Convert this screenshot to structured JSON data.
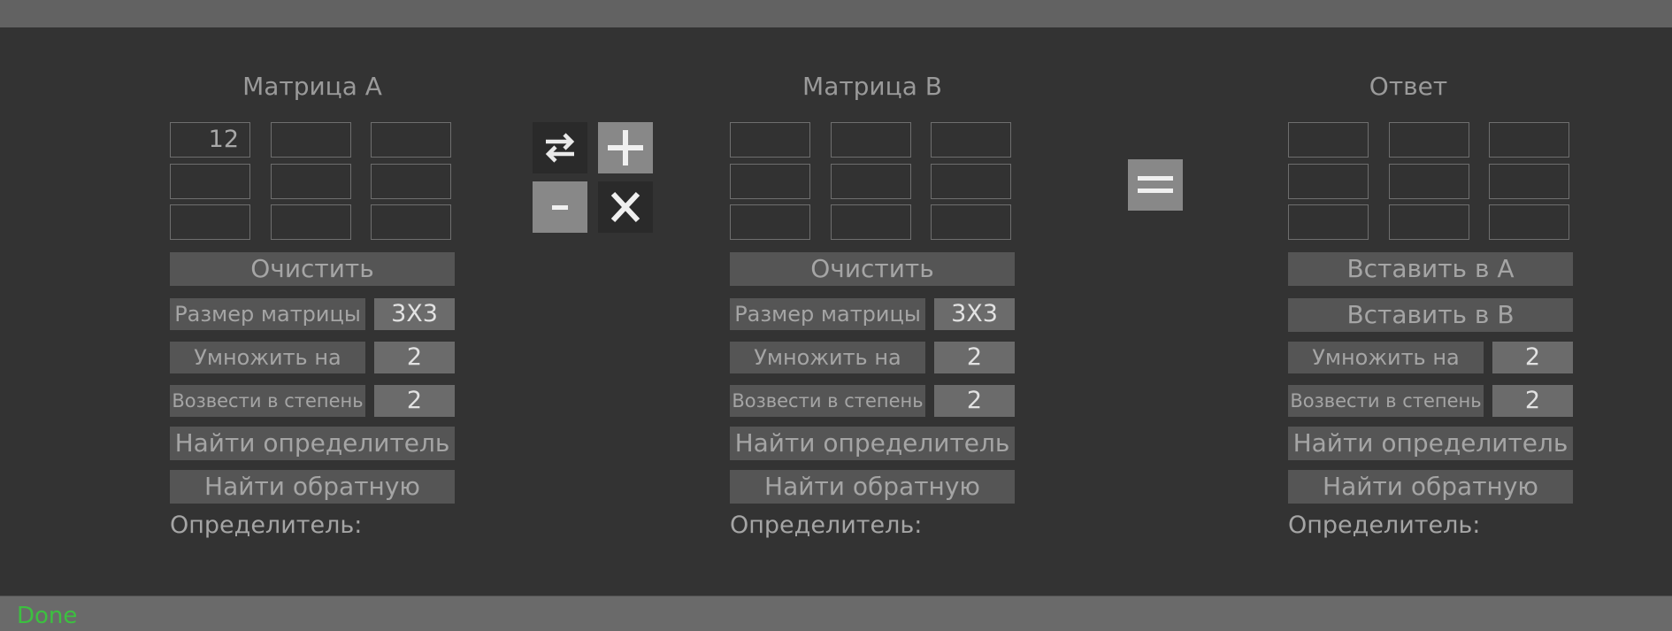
{
  "matrix_a": {
    "title": "Матрица А",
    "cells": [
      "12",
      "",
      "",
      "",
      "",
      "",
      "",
      "",
      ""
    ],
    "clear_label": "Очистить",
    "size_label": "Размер матрицы",
    "size_value": "3X3",
    "multiply_label": "Умножить на",
    "multiply_value": "2",
    "power_label": "Возвести в степень",
    "power_value": "2",
    "determinant_btn": "Найти определитель",
    "inverse_btn": "Найти обратную",
    "determinant_label": "Определитель:"
  },
  "operations": {
    "swap": "⇄",
    "add": "+",
    "subtract": "-",
    "multiply": "X"
  },
  "matrix_b": {
    "title": "Матрица B",
    "cells": [
      "",
      "",
      "",
      "",
      "",
      "",
      "",
      "",
      ""
    ],
    "clear_label": "Очистить",
    "size_label": "Размер матрицы",
    "size_value": "3X3",
    "multiply_label": "Умножить на",
    "multiply_value": "2",
    "power_label": "Возвести в степень",
    "power_value": "2",
    "determinant_btn": "Найти определитель",
    "inverse_btn": "Найти обратную",
    "determinant_label": "Определитель:"
  },
  "equals": {
    "icon": "equals-icon"
  },
  "answer": {
    "title": "Ответ",
    "cells": [
      "",
      "",
      "",
      "",
      "",
      "",
      "",
      "",
      ""
    ],
    "insert_a_label": "Вставить в А",
    "insert_b_label": "Вставить в B",
    "multiply_label": "Умножить на",
    "multiply_value": "2",
    "power_label": "Возвести в степень",
    "power_value": "2",
    "determinant_btn": "Найти определитель",
    "inverse_btn": "Найти обратную",
    "determinant_label": "Определитель:"
  },
  "status": {
    "text": "Done",
    "color": "#3cc040"
  },
  "colors": {
    "background": "#333333",
    "button": "#555555",
    "value_box": "#6b6b6b",
    "op_light": "#888888"
  }
}
